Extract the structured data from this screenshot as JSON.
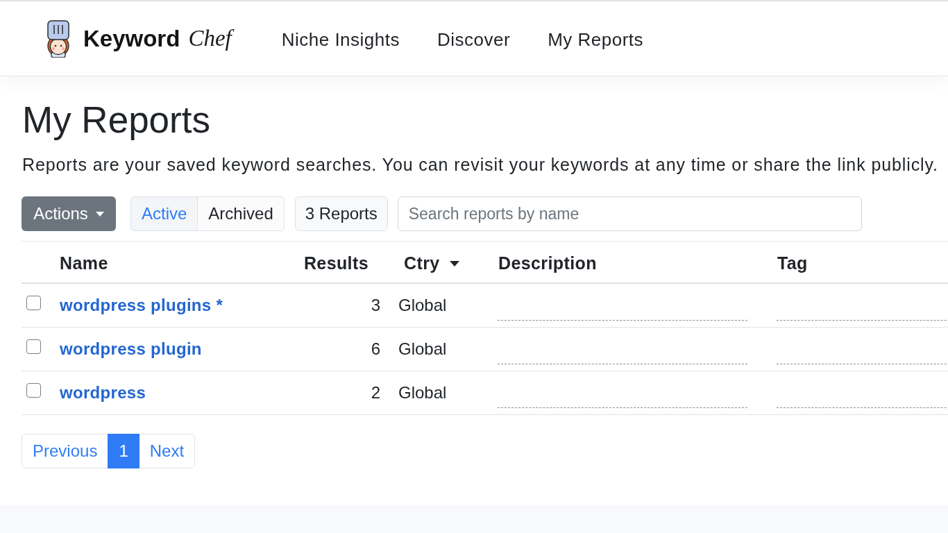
{
  "header": {
    "brand": {
      "name": "Keyword",
      "script": "Chef"
    },
    "nav": [
      "Niche Insights",
      "Discover",
      "My Reports"
    ]
  },
  "page": {
    "title": "My Reports",
    "description": "Reports are your saved keyword searches. You can revisit your keywords at any time or share the link publicly."
  },
  "toolbar": {
    "actions": {
      "label": "Actions"
    },
    "filters": [
      {
        "label": "Active",
        "selected": true
      },
      {
        "label": "Archived",
        "selected": false
      }
    ],
    "count": "3 Reports",
    "search": {
      "placeholder": "Search reports by name"
    }
  },
  "table": {
    "columns": [
      {
        "label": "Name",
        "kind": "link"
      },
      {
        "label": "Results",
        "kind": "number"
      },
      {
        "label": "Ctry",
        "kind": "menu"
      },
      {
        "label": "Description",
        "kind": "editable"
      },
      {
        "label": "Tag",
        "kind": "editable"
      }
    ],
    "rows": [
      {
        "checked": false,
        "cells": [
          "wordpress plugins *",
          "3",
          "Global"
        ]
      },
      {
        "checked": false,
        "cells": [
          "wordpress plugin",
          "6",
          "Global"
        ]
      },
      {
        "checked": false,
        "cells": [
          "wordpress",
          "2",
          "Global"
        ]
      }
    ]
  },
  "pagination": [
    {
      "label": "Previous",
      "selected": false
    },
    {
      "label": "1",
      "selected": true
    },
    {
      "label": "Next",
      "selected": false
    }
  ]
}
